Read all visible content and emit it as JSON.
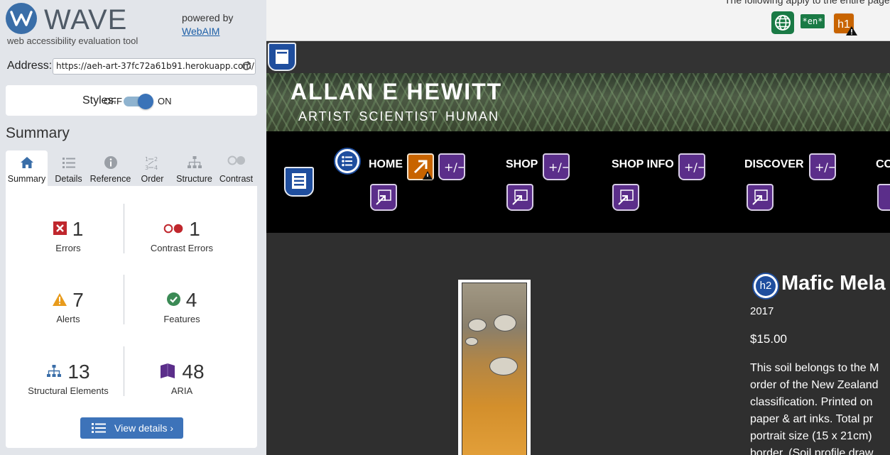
{
  "wave": {
    "logo_text": "WAVE",
    "tagline": "web accessibility evaluation tool",
    "powered_by": "powered by",
    "webaim_link": "WebAIM",
    "address_label": "Address:",
    "address_value": "https://aeh-art-37fc72a61b91.herokuapp.com/",
    "styles_label": "Styles:",
    "styles_off": "OFF",
    "styles_on": "ON",
    "styles_enabled": true,
    "summary_heading": "Summary",
    "tabs": [
      {
        "label": "Summary",
        "icon": "home-icon",
        "active": true
      },
      {
        "label": "Details",
        "icon": "list-icon",
        "active": false
      },
      {
        "label": "Reference",
        "icon": "info-icon",
        "active": false
      },
      {
        "label": "Order",
        "icon": "order-icon",
        "active": false
      },
      {
        "label": "Structure",
        "icon": "structure-icon",
        "active": false
      },
      {
        "label": "Contrast",
        "icon": "contrast-icon",
        "active": false
      }
    ],
    "stats": {
      "errors": {
        "count": "1",
        "label": "Errors"
      },
      "contrast_errors": {
        "count": "1",
        "label": "Contrast Errors"
      },
      "alerts": {
        "count": "7",
        "label": "Alerts"
      },
      "features": {
        "count": "4",
        "label": "Features"
      },
      "structural": {
        "count": "13",
        "label": "Structural Elements"
      },
      "aria": {
        "count": "48",
        "label": "ARIA"
      }
    },
    "view_details": "View details ›",
    "colors": {
      "accent": "#3d73b9",
      "error": "#c0272d",
      "alert": "#e89b1c",
      "feature": "#3b8a55",
      "aria": "#5b2e8a"
    }
  },
  "page": {
    "top_note": "The following apply to the entire page:",
    "lang_badge": "*en*",
    "h1_badge": "h1",
    "site_title": "ALLAN E HEWITT",
    "site_subtitle": "ARTIST  SCIENTIST  HUMAN",
    "nav": [
      "HOME",
      "SHOP",
      "SHOP INFO",
      "DISCOVER",
      "CO"
    ],
    "h2_badge": "h2",
    "product_title": "Mafic Mela",
    "product_year": "2017",
    "product_price": "$15.00",
    "product_desc": [
      "This soil belongs to the M",
      "order of the New Zealand",
      "classification. Printed on",
      "paper & art inks. Total pr",
      "portrait size (15 x 21cm)",
      "border. (Soil profile draw"
    ]
  }
}
